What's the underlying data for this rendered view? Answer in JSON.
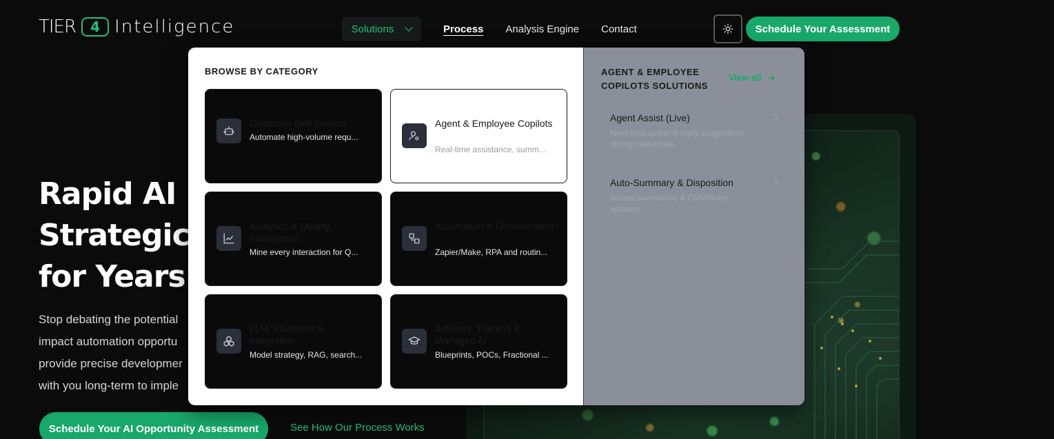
{
  "logo": {
    "tier": "TIER",
    "number": "4",
    "intelligence": "Intelligence"
  },
  "nav": {
    "solutions": "Solutions",
    "links": [
      "Process",
      "Analysis Engine",
      "Contact"
    ]
  },
  "header": {
    "theme_icon": "sun-icon",
    "cta": "Schedule Your Assessment"
  },
  "hero": {
    "title_lines": [
      "Rapid AI",
      "Strategic",
      "for Years"
    ],
    "text_lines": [
      "Stop debating the potential",
      "impact automation opportu",
      "provide precise developmer",
      "with you long-term to imple"
    ],
    "cta": "Schedule Your AI Opportunity Assessment",
    "secondary_link": "See How Our Process Works"
  },
  "menu": {
    "browse_heading": "BROWSE BY CATEGORY",
    "categories": [
      {
        "title": "Customer Self-Service",
        "desc": "Automate high-volume requ...",
        "icon": "bot-icon"
      },
      {
        "title": "Agent & Employee Copilots",
        "desc": "Real-time assistance, summ...",
        "icon": "user-gear-icon"
      },
      {
        "title": "Analytics & Quality Intelligence",
        "desc": "Mine every interaction for Q...",
        "icon": "chart-line-icon"
      },
      {
        "title": "Automation & Orchestration",
        "desc": "Zapier/Make, RPA and routin...",
        "icon": "workflow-icon"
      },
      {
        "title": "LLM, Platforms & Integration",
        "desc": "Model strategy, RAG, search...",
        "icon": "boxes-icon"
      },
      {
        "title": "Advisory, Training & Managed AI",
        "desc": "Blueprints, POCs, Fractional ...",
        "icon": "graduation-cap-icon"
      }
    ],
    "solutions_heading_lines": [
      "AGENT & EMPLOYEE",
      "COPILOTS SOLUTIONS"
    ],
    "view_all": "View all",
    "solutions": [
      {
        "title": "Agent Assist (Live)",
        "desc": "Next-best-action & reply suggestions during calls/chats."
      },
      {
        "title": "Auto-Summary & Disposition",
        "desc": "Instant summaries & CRM/ticket updates."
      }
    ]
  },
  "colors": {
    "accent": "#17a86a",
    "background": "#0b0b0b",
    "menu_right": "#8b8f99"
  }
}
